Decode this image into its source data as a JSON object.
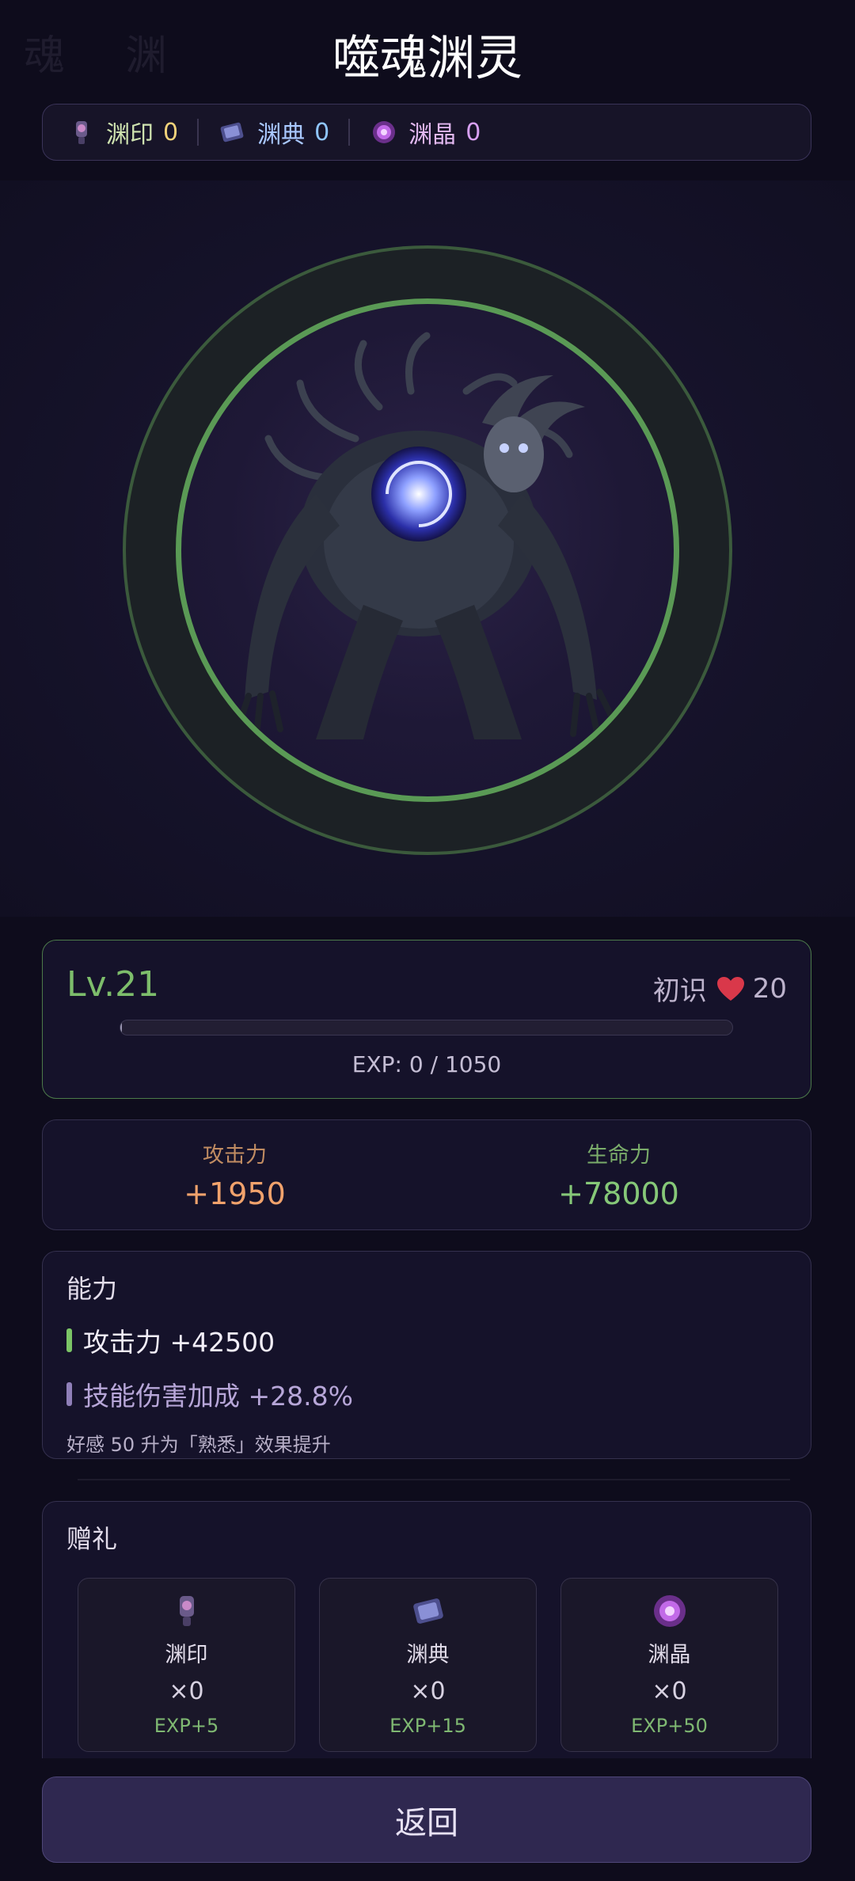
{
  "page": {
    "title": "噬魂渊灵",
    "background_watermark": "魂 渊"
  },
  "currencies": [
    {
      "icon": "seal-icon",
      "label": "渊印",
      "value": "0"
    },
    {
      "icon": "book-icon",
      "label": "渊典",
      "value": "0"
    },
    {
      "icon": "crystal-icon",
      "label": "渊晶",
      "value": "0"
    }
  ],
  "level_card": {
    "level": "Lv.21",
    "affinity_label": "初识",
    "affinity_value": "20",
    "exp_text": "EXP: 0 / 1050",
    "exp_progress": 0
  },
  "stats": {
    "attack_label": "攻击力",
    "attack_value": "+1950",
    "hp_label": "生命力",
    "hp_value": "+78000"
  },
  "ability": {
    "title": "能力",
    "lines": [
      "攻击力 +42500",
      "技能伤害加成 +28.8%"
    ],
    "note": "好感 50 升为「熟悉」效果提升"
  },
  "gifts": {
    "title": "赠礼",
    "items": [
      {
        "icon": "seal-icon",
        "name": "渊印",
        "count": "×0",
        "exp": "EXP+5"
      },
      {
        "icon": "book-icon",
        "name": "渊典",
        "count": "×0",
        "exp": "EXP+15"
      },
      {
        "icon": "crystal-icon",
        "name": "渊晶",
        "count": "×0",
        "exp": "EXP+50"
      }
    ]
  },
  "back_button": "返回",
  "colors": {
    "accent_green": "#5a9a55",
    "attack": "#f1a26c",
    "hp": "#86c878",
    "heart": "#d9384a"
  }
}
